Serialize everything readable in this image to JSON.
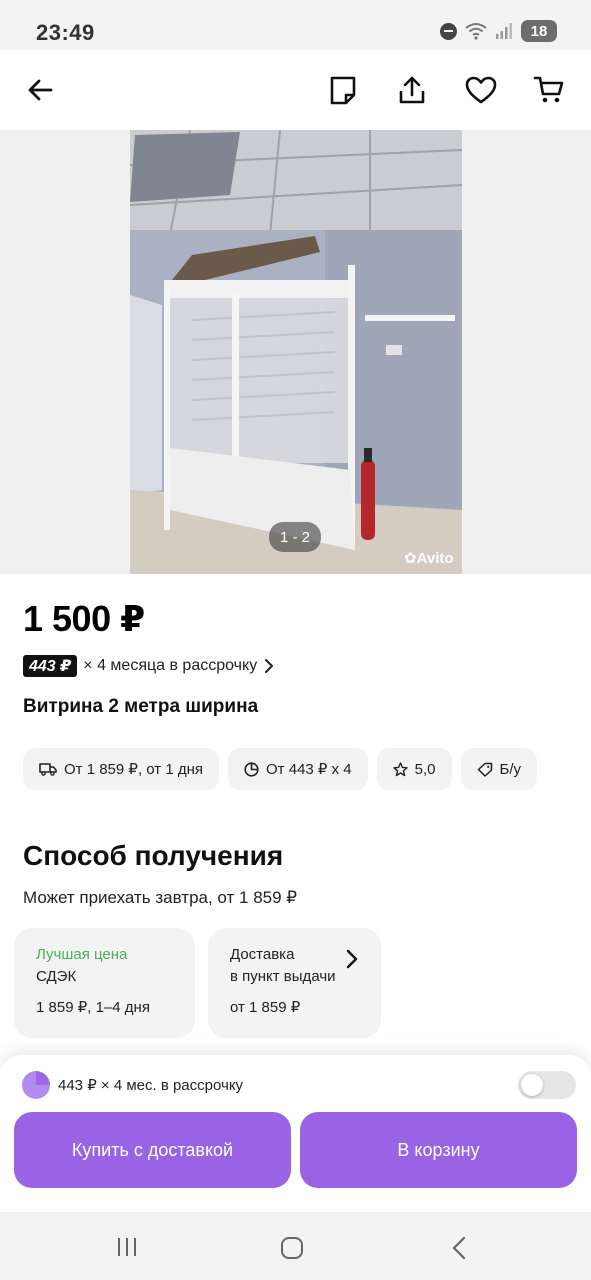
{
  "status_bar": {
    "time": "23:49",
    "battery": "18",
    "icons": [
      "do-not-disturb-icon",
      "wifi-icon",
      "signal-icon",
      "battery-icon"
    ]
  },
  "toolbar": {
    "icons": [
      "back-arrow-icon",
      "note-icon",
      "share-icon",
      "heart-icon",
      "cart-icon"
    ]
  },
  "gallery": {
    "counter": "1 - 2",
    "watermark": "Avito"
  },
  "product": {
    "price": "1 500 ₽",
    "installment_badge": "443 ₽",
    "installment_text": "× 4 месяца в рассрочку",
    "title": "Витрина 2 метра ширина"
  },
  "chips": [
    {
      "label": "От 1 859 ₽, от 1 дня",
      "icon": "truck-icon"
    },
    {
      "label": "От 443 ₽ x 4",
      "icon": "pie-chart-icon"
    },
    {
      "label": "5,0",
      "icon": "star-icon"
    },
    {
      "label": "Б/у",
      "icon": "tag-icon"
    }
  ],
  "delivery": {
    "title": "Способ получения",
    "subtitle": "Может приехать завтра, от 1 859 ₽",
    "cards": [
      {
        "badge": "Лучшая цена",
        "name": "СДЭК",
        "detail": "1 859 ₽, 1–4 дня"
      },
      {
        "line1": "Доставка",
        "line2": "в пункт выдачи",
        "detail": "от 1 859 ₽"
      }
    ]
  },
  "bottom_sheet": {
    "installment": "443 ₽ × 4 мес. в рассрочку",
    "toggle_on": false,
    "buy_label": "Купить с доставкой",
    "cart_label": "В корзину"
  },
  "colors": {
    "accent": "#9a63e6",
    "best_price": "#4cae5a",
    "chip_bg": "#f3f3f3"
  }
}
